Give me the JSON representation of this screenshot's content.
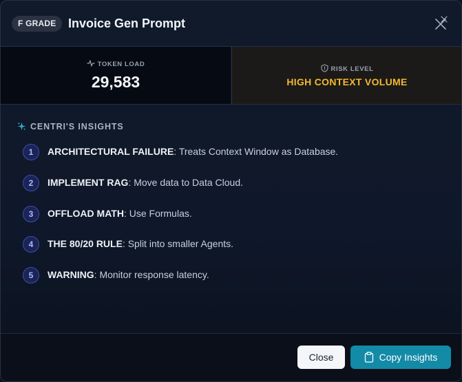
{
  "header": {
    "grade_badge": "F GRADE",
    "title": "Invoice Gen Prompt",
    "close_icon": "close-icon"
  },
  "stats": {
    "token_load": {
      "label": "TOKEN LOAD",
      "value": "29,583",
      "icon": "activity-icon"
    },
    "risk_level": {
      "label": "RISK LEVEL",
      "value": "HIGH CONTEXT VOLUME",
      "icon": "shield-icon",
      "color": "#f5b830"
    }
  },
  "insights": {
    "heading": "CENTRI'S INSIGHTS",
    "icon": "sparkle-icon",
    "items": [
      {
        "number": "1",
        "title": "ARCHITECTURAL FAILURE",
        "text": ": Treats Context Window as Database."
      },
      {
        "number": "2",
        "title": "IMPLEMENT RAG",
        "text": ": Move data to Data Cloud."
      },
      {
        "number": "3",
        "title": "OFFLOAD MATH",
        "text": ": Use Formulas."
      },
      {
        "number": "4",
        "title": "THE 80/20 RULE",
        "text": ": Split into smaller Agents."
      },
      {
        "number": "5",
        "title": "WARNING",
        "text": ": Monitor response latency."
      }
    ]
  },
  "footer": {
    "close_label": "Close",
    "copy_label": "Copy Insights",
    "copy_icon": "clipboard-icon",
    "accent": "#138aa6"
  }
}
